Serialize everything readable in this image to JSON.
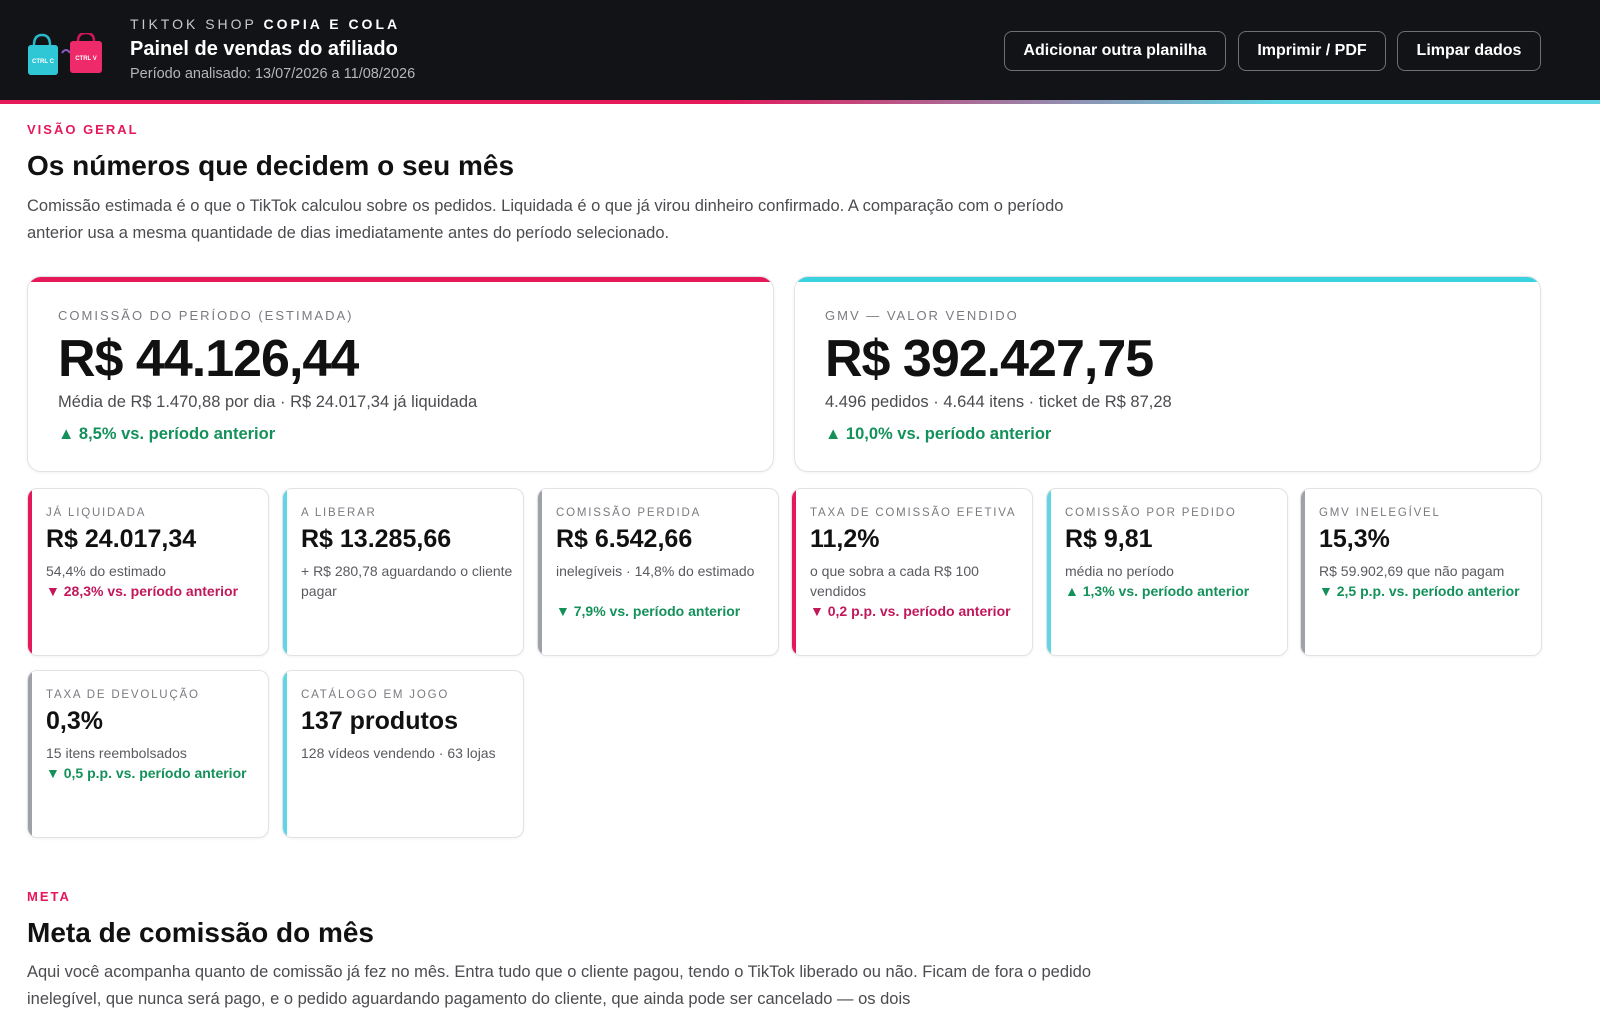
{
  "header": {
    "brand_light": "TIKTOK SHOP",
    "brand_bold": "COPIA E COLA",
    "title": "Painel de vendas do afiliado",
    "period": "Período analisado: 13/07/2026 a 11/08/2026",
    "logo_left_text": "CTRL C",
    "logo_right_text": "CTRL V",
    "buttons": {
      "add": "Adicionar outra planilha",
      "print": "Imprimir / PDF",
      "clear": "Limpar dados"
    }
  },
  "overview": {
    "eyebrow": "VISÃO GERAL",
    "title": "Os números que decidem o seu mês",
    "lead": "Comissão estimada é o que o TikTok calculou sobre os pedidos. Liquidada é o que já virou dinheiro confirmado. A comparação com o período anterior usa a mesma quantidade de dias imediatamente antes do período selecionado."
  },
  "big_cards": [
    {
      "label": "COMISSÃO DO PERÍODO (ESTIMADA)",
      "value": "R$ 44.126,44",
      "sub": "Média de R$ 1.470,88 por dia · R$ 24.017,34 já liquidada",
      "delta": "▲ 8,5% vs. período anterior",
      "trend": "up",
      "accent": "#e5185a"
    },
    {
      "label": "GMV — VALOR VENDIDO",
      "value": "R$ 392.427,75",
      "sub": "4.496 pedidos · 4.644 itens · ticket de R$ 87,28",
      "delta": "▲ 10,0% vs. período anterior",
      "trend": "up",
      "accent": "#38d3df"
    }
  ],
  "cards": [
    {
      "label": "JÁ LIQUIDADA",
      "value": "R$ 24.017,34",
      "sub": "54,4% do estimado",
      "delta": "▼ 28,3% vs. período anterior",
      "trend": "down",
      "accent": "#e5185a"
    },
    {
      "label": "A LIBERAR",
      "value": "R$ 13.285,66",
      "sub": "+ R$ 280,78 aguardando o cliente pagar",
      "delta": "",
      "trend": "none",
      "accent": "#5fd6e4"
    },
    {
      "label": "COMISSÃO PERDIDA",
      "value": "R$ 6.542,66",
      "sub": "inelegíveis · 14,8% do estimado",
      "delta": "▼ 7,9% vs. período anterior",
      "trend": "up",
      "accent": "#9ea1a8"
    },
    {
      "label": "TAXA DE COMISSÃO EFETIVA",
      "value": "11,2%",
      "sub": "o que sobra a cada R$ 100 vendidos",
      "delta": "▼ 0,2 p.p. vs. período anterior",
      "trend": "down",
      "accent": "#e5185a"
    },
    {
      "label": "COMISSÃO POR PEDIDO",
      "value": "R$ 9,81",
      "sub": "média no período",
      "delta": "▲ 1,3% vs. período anterior",
      "trend": "up",
      "accent": "#5fd6e4"
    },
    {
      "label": "GMV INELEGÍVEL",
      "value": "15,3%",
      "sub": "R$ 59.902,69 que não pagam",
      "delta": "▼ 2,5 p.p. vs. período anterior",
      "trend": "up",
      "accent": "#9ea1a8"
    },
    {
      "label": "TAXA DE DEVOLUÇÃO",
      "value": "0,3%",
      "sub": "15 itens reembolsados",
      "delta": "▼ 0,5 p.p. vs. período anterior",
      "trend": "up",
      "accent": "#9ea1a8"
    },
    {
      "label": "CATÁLOGO EM JOGO",
      "value": "137 produtos",
      "sub": "128 vídeos vendendo · 63 lojas",
      "delta": "",
      "trend": "none",
      "accent": "#5fd6e4"
    }
  ],
  "meta": {
    "eyebrow": "META",
    "title": "Meta de comissão do mês",
    "lead": "Aqui você acompanha quanto de comissão já fez no mês. Entra tudo que o cliente pagou, tendo o TikTok liberado ou não. Ficam de fora o pedido inelegível, que nunca será pago, e o pedido aguardando pagamento do cliente, que ainda pode ser cancelado — os dois"
  },
  "colors": {
    "header_bg": "#121316",
    "pink": "#e5185a",
    "cyan": "#38d3df",
    "up": "#14915a",
    "down": "#c2185b"
  }
}
